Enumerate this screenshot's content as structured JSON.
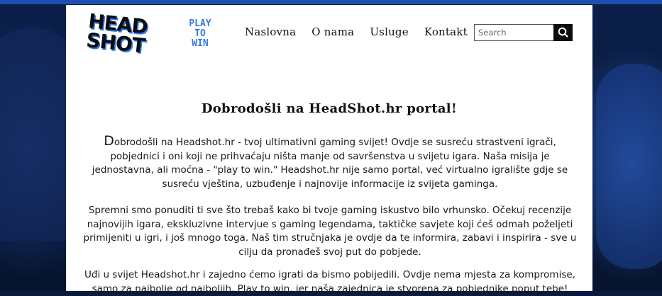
{
  "logo": {
    "line1": "HEAD",
    "line2": "SHOT",
    "tag1": "PLAY",
    "tag2": "TO",
    "tag3": "WIN"
  },
  "nav": {
    "items": [
      {
        "label": "Naslovna"
      },
      {
        "label": "O nama"
      },
      {
        "label": "Usluge"
      },
      {
        "label": "Kontakt"
      }
    ]
  },
  "search": {
    "placeholder": "Search"
  },
  "main": {
    "headline": "Dobrodošli na HeadShot.hr portal!",
    "p1_first": "D",
    "p1_rest": "obrodošli na Headshot.hr - tvoj ultimativni gaming svijet! Ovdje se susreću strastveni igrači, pobjednici i oni koji ne prihvaćaju ništa manje od savršenstva u svijetu igara. Naša misija je jednostavna, ali moćna - \"play to win.\" Headshot.hr nije samo portal, već virtualno igralište gdje se susreću vještina, uzbuđenje i najnovije informacije iz svijeta gaminga.",
    "p2": "Spremni smo ponuditi ti sve što trebaš kako bi tvoje gaming iskustvo bilo vrhunsko. Očekuj recenzije najnovijih igara, ekskluzivne intervjue s gaming legendama, taktičke savjete koji ćeš odmah poželjeti primijeniti u igri, i još mnogo toga. Naš tim stručnjaka je ovdje da te informira, zabavi i inspirira - sve u cilju da pronađeš svoj put do pobjede.",
    "p3": "Uđi u svijet Headshot.hr i zajedno ćemo igrati da bismo pobijedili. Ovdje nema mjesta za kompromise, samo za najbolje od najboljih. Play to win, jer naša zajednica je stvorena za pobjednike poput tebe!"
  },
  "colors": {
    "accent": "#2f7ae5",
    "background": "#0a1a3e",
    "panel": "#ffffff"
  }
}
